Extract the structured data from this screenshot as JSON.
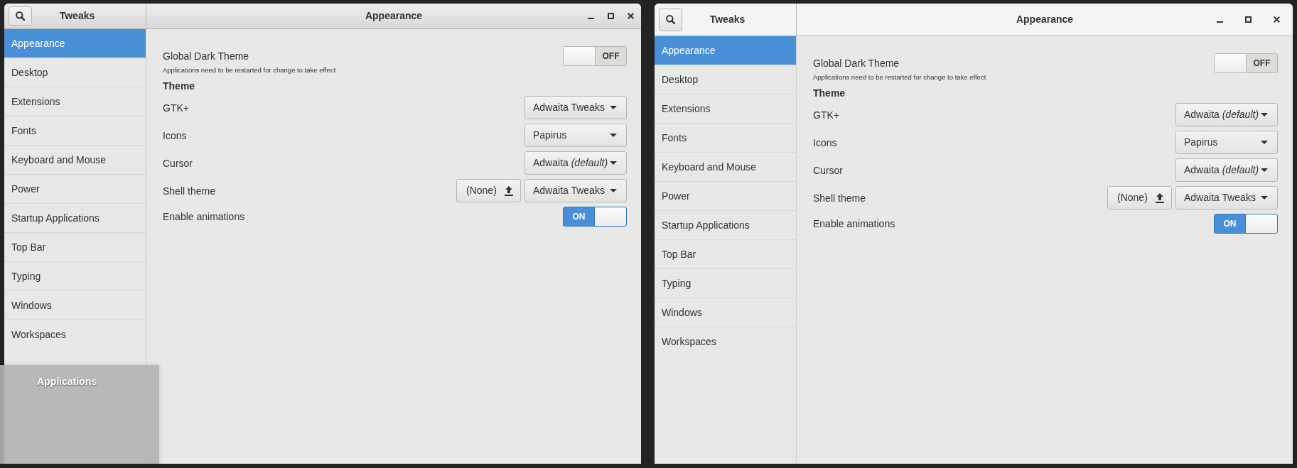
{
  "windows": [
    {
      "focused": true,
      "app_title": "Tweaks",
      "title": "Appearance",
      "sidebar": {
        "items": [
          {
            "label": "Appearance",
            "selected": true
          },
          {
            "label": "Desktop",
            "selected": false
          },
          {
            "label": "Extensions",
            "selected": false
          },
          {
            "label": "Fonts",
            "selected": false
          },
          {
            "label": "Keyboard and Mouse",
            "selected": false
          },
          {
            "label": "Power",
            "selected": false
          },
          {
            "label": "Startup Applications",
            "selected": false
          },
          {
            "label": "Top Bar",
            "selected": false
          },
          {
            "label": "Typing",
            "selected": false
          },
          {
            "label": "Windows",
            "selected": false
          },
          {
            "label": "Workspaces",
            "selected": false
          }
        ]
      },
      "settings": [
        {
          "kind": "switch",
          "label": "Global Dark Theme",
          "subtitle": "Applications need to be restarted for change to take effect",
          "on": false,
          "state_text": "OFF"
        },
        {
          "kind": "heading",
          "label": "Theme"
        },
        {
          "kind": "dropdown",
          "label": "GTK+",
          "value": "Adwaita Tweaks"
        },
        {
          "kind": "dropdown",
          "label": "Icons",
          "value": "Papirus"
        },
        {
          "kind": "dropdown",
          "label": "Cursor",
          "value": "Adwaita *(default)*"
        },
        {
          "kind": "file_dropdown",
          "label": "Shell theme",
          "file_button": "(None)",
          "value": "Adwaita Tweaks"
        },
        {
          "kind": "switch",
          "label": "Enable animations",
          "on": true,
          "state_text": "ON"
        }
      ],
      "overlay": {
        "label": "Applications"
      }
    },
    {
      "focused": false,
      "app_title": "Tweaks",
      "title": "Appearance",
      "sidebar": {
        "items": [
          {
            "label": "Appearance",
            "selected": true
          },
          {
            "label": "Desktop",
            "selected": false
          },
          {
            "label": "Extensions",
            "selected": false
          },
          {
            "label": "Fonts",
            "selected": false
          },
          {
            "label": "Keyboard and Mouse",
            "selected": false
          },
          {
            "label": "Power",
            "selected": false
          },
          {
            "label": "Startup Applications",
            "selected": false
          },
          {
            "label": "Top Bar",
            "selected": false
          },
          {
            "label": "Typing",
            "selected": false
          },
          {
            "label": "Windows",
            "selected": false
          },
          {
            "label": "Workspaces",
            "selected": false
          }
        ]
      },
      "settings": [
        {
          "kind": "switch",
          "label": "Global Dark Theme",
          "subtitle": "Applications need to be restarted for change to take effect",
          "on": false,
          "state_text": "OFF"
        },
        {
          "kind": "heading",
          "label": "Theme"
        },
        {
          "kind": "dropdown",
          "label": "GTK+",
          "value": "Adwaita *(default)*"
        },
        {
          "kind": "dropdown",
          "label": "Icons",
          "value": "Papirus"
        },
        {
          "kind": "dropdown",
          "label": "Cursor",
          "value": "Adwaita *(default)*"
        },
        {
          "kind": "file_dropdown",
          "label": "Shell theme",
          "file_button": "(None)",
          "value": "Adwaita Tweaks"
        },
        {
          "kind": "switch",
          "label": "Enable animations",
          "on": true,
          "state_text": "ON"
        }
      ]
    }
  ]
}
